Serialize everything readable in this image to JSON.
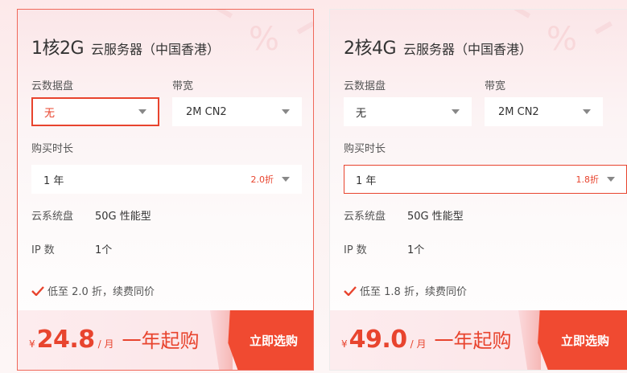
{
  "cards": [
    {
      "spec": "1核2G",
      "name": "云服务器（中国香港）",
      "disk_label": "云数据盘",
      "disk_value": "无",
      "bandwidth_label": "带宽",
      "bandwidth_value": "2M CN2",
      "duration_label": "购买时长",
      "duration_value": "1 年",
      "duration_discount": "2.0折",
      "system_disk_key": "云系统盘",
      "system_disk_value": "50G 性能型",
      "ip_key": "IP 数",
      "ip_value": "1个",
      "promo": "低至 2.0 折，续费同价",
      "currency": "¥",
      "price": "24.8",
      "unit": "/ 月",
      "slogan": "一年起购",
      "buy_label": "立即选购"
    },
    {
      "spec": "2核4G",
      "name": "云服务器（中国香港）",
      "disk_label": "云数据盘",
      "disk_value": "无",
      "bandwidth_label": "带宽",
      "bandwidth_value": "2M CN2",
      "duration_label": "购买时长",
      "duration_value": "1 年",
      "duration_discount": "1.8折",
      "system_disk_key": "云系统盘",
      "system_disk_value": "50G 性能型",
      "ip_key": "IP 数",
      "ip_value": "1个",
      "promo": "低至 1.8 折，续费同价",
      "currency": "¥",
      "price": "49.0",
      "unit": "/ 月",
      "slogan": "一年起购",
      "buy_label": "立即选购"
    }
  ],
  "colors": {
    "accent": "#e8442e",
    "buy": "#f04a31"
  }
}
